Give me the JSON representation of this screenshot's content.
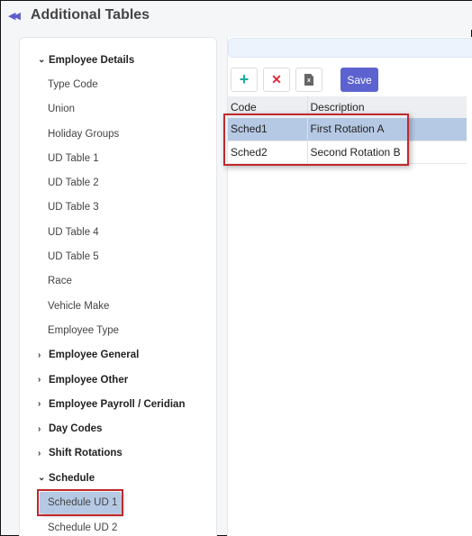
{
  "header": {
    "collapse_icon": "double-chevron-left-icon",
    "title": "Additional Tables"
  },
  "sidebar": {
    "groups": [
      {
        "label": "Employee Details",
        "expanded": true,
        "items": [
          "Type Code",
          "Union",
          "Holiday Groups",
          "UD Table 1",
          "UD Table 2",
          "UD Table 3",
          "UD Table 4",
          "UD Table 5",
          "Race",
          "Vehicle Make",
          "Employee Type"
        ]
      },
      {
        "label": "Employee General",
        "expanded": false
      },
      {
        "label": "Employee Other",
        "expanded": false
      },
      {
        "label": "Employee Payroll / Ceridian",
        "expanded": false
      },
      {
        "label": "Day Codes",
        "expanded": false
      },
      {
        "label": "Shift Rotations",
        "expanded": false
      },
      {
        "label": "Schedule",
        "expanded": true,
        "items": [
          "Schedule UD 1",
          "Schedule UD 2"
        ],
        "selected_item": "Schedule UD 1"
      }
    ]
  },
  "toolbar": {
    "add_icon": "+",
    "delete_icon": "✕",
    "export_icon": "x",
    "save_label": "Save"
  },
  "grid": {
    "columns": [
      "Code",
      "Description"
    ],
    "rows": [
      {
        "code": "Sched1",
        "description": "First Rotation A",
        "selected": true
      },
      {
        "code": "Sched2",
        "description": "Second Rotation B",
        "selected": false
      }
    ]
  },
  "colors": {
    "accent": "#5c63d0",
    "selection": "#b6c9e4",
    "highlight_border": "#c0292e",
    "add": "#1fa89a",
    "delete": "#e3283a"
  }
}
